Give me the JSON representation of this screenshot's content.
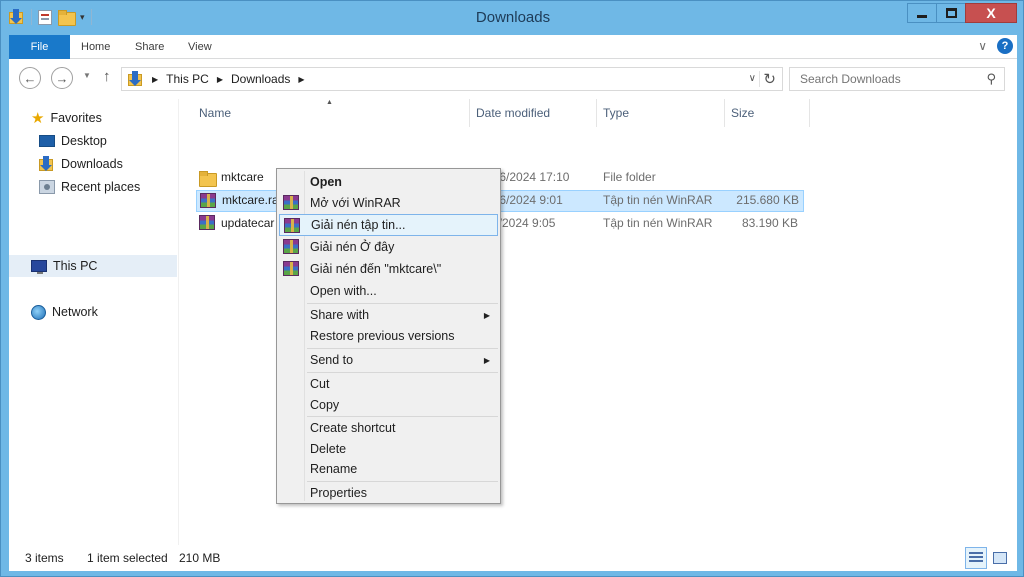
{
  "window": {
    "title": "Downloads",
    "controls": {
      "minimize": "–",
      "close": "X"
    }
  },
  "ribbon": {
    "tabs": [
      "File",
      "Home",
      "Share",
      "View"
    ]
  },
  "navbar": {
    "back_icon": "←",
    "forward_icon": "→",
    "up_icon": "↑",
    "breadcrumb": [
      "This PC",
      "Downloads"
    ],
    "search_placeholder": "Search Downloads"
  },
  "sidebar": {
    "items": [
      {
        "label": "Favorites",
        "icon": "star-icon"
      },
      {
        "label": "Desktop",
        "icon": "desktop-icon"
      },
      {
        "label": "Downloads",
        "icon": "downloads-folder-icon"
      },
      {
        "label": "Recent places",
        "icon": "recent-places-icon"
      },
      {
        "label": "This PC",
        "icon": "computer-icon"
      },
      {
        "label": "Network",
        "icon": "network-icon"
      }
    ]
  },
  "columns": [
    "Name",
    "Date modified",
    "Type",
    "Size"
  ],
  "files": [
    {
      "name": "mktcare",
      "date": "15/06/2024 17:10",
      "type": "File folder",
      "size": ""
    },
    {
      "name": "mktcare.rar",
      "date": "15/06/2024 9:01",
      "type": "Tập tin nén WinRAR",
      "size": "215.680 KB"
    },
    {
      "name": "updatecar",
      "date": "6/2024 9:05",
      "type": "Tập tin nén WinRAR",
      "size": "83.190 KB"
    }
  ],
  "context_menu": {
    "items": [
      "Open",
      "Mở với WinRAR",
      "Giải nén tập tin...",
      "Giải nén Ở đây",
      "Giải nén đến \"mktcare\\\"",
      "Open with...",
      "Share with",
      "Restore previous versions",
      "Send to",
      "Cut",
      "Copy",
      "Create shortcut",
      "Delete",
      "Rename",
      "Properties"
    ]
  },
  "status": {
    "item_count": "3 items",
    "selected": "1 item selected",
    "size": "210 MB"
  }
}
